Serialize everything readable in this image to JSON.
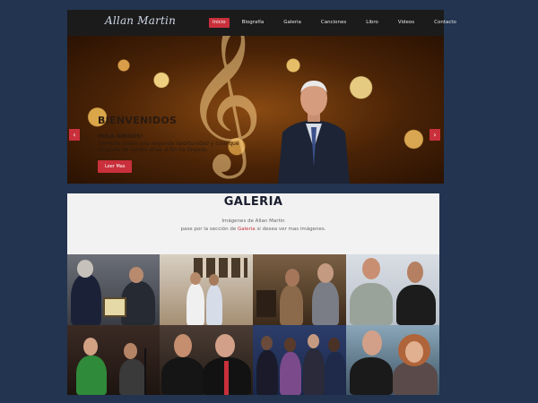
{
  "nav": {
    "brand": "Allan Martin",
    "items": [
      "Inicio",
      "Biografía",
      "Galeria",
      "Canciones",
      "Libro",
      "Videos",
      "Contacto"
    ],
    "active_index": 0
  },
  "hero": {
    "title": "BIENVENIDOS",
    "subtitle": "HOLA AMIGOS!",
    "body": "Siempre existe una segunda oportunidad y creo que después de tantos años al fin ha llegado.",
    "button": "Leer Mas",
    "prev_icon": "chevron-left-icon",
    "next_icon": "chevron-right-icon"
  },
  "gallery": {
    "title": "GALERIA",
    "line1": "Imágenes de Allan Martin",
    "line2_pre": "pase por la sección de",
    "line2_link": "Galeria",
    "line2_post": "si desea ver mas imágenes."
  },
  "colors": {
    "page_bg": "#22344f",
    "nav_bg": "#1b1b1b",
    "accent": "#c9303b",
    "gallery_bg": "#f2f2f2"
  }
}
